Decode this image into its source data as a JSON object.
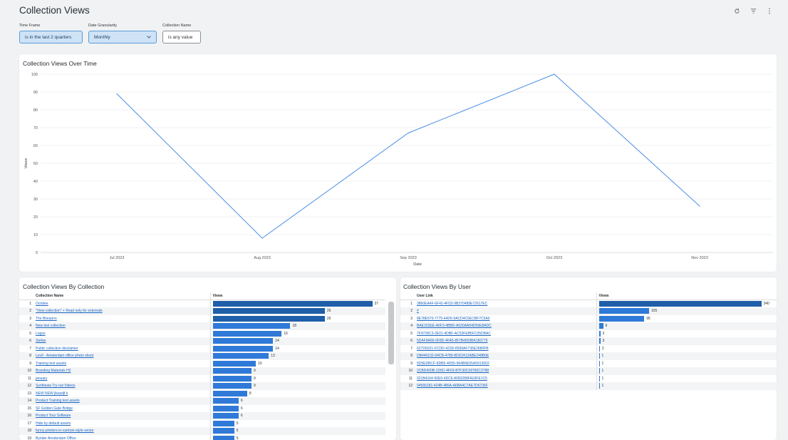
{
  "page": {
    "title": "Collection Views"
  },
  "filters": [
    {
      "label": "Time Frame",
      "value": "is in the last 2 quarters"
    },
    {
      "label": "Date Granularity",
      "value": "Monthly"
    },
    {
      "label": "Collection Name",
      "value": "is any value"
    }
  ],
  "icons": [
    "refresh-icon",
    "filter-icon",
    "more-vert-icon"
  ],
  "colors": {
    "accent": "#4a8fe6",
    "bar_dark": "#1f5ea8",
    "bar_light": "#2f7ad8",
    "link": "#1a66c2"
  },
  "chart_data": {
    "type": "line",
    "title": "Collection Views Over Time",
    "xlabel": "Date",
    "ylabel": "Views",
    "x": [
      "Jul 2023",
      "Aug 2023",
      "Sep 2023",
      "Oct 2023",
      "Nov 2023"
    ],
    "series": [
      {
        "values": [
          89,
          8,
          67,
          100,
          26
        ]
      }
    ],
    "ylim": [
      0,
      100
    ],
    "yticks": [
      0,
      10,
      20,
      30,
      40,
      50,
      60,
      70,
      80,
      90,
      100
    ],
    "grid": true
  },
  "by_collection": {
    "title": "Collection Views By Collection",
    "col_name": "Collection Name",
    "col_views": "Views",
    "max": 37,
    "rows": [
      {
        "n": "1",
        "name": "October",
        "views": 37
      },
      {
        "n": "2",
        "name": "\"View collection\" + Read only for externals",
        "views": 26
      },
      {
        "n": "3",
        "name": "The Bloopers",
        "views": 26
      },
      {
        "n": "4",
        "name": "New test collection",
        "views": 18
      },
      {
        "n": "5",
        "name": "Logos",
        "views": 16
      },
      {
        "n": "6",
        "name": "Stefan",
        "views": 14
      },
      {
        "n": "7",
        "name": "Public collection disclaimer",
        "views": 14
      },
      {
        "n": "8",
        "name": "Lev9 - Amsterdam office photo shoot",
        "views": 13
      },
      {
        "n": "9",
        "name": "Training test assets",
        "views": 10
      },
      {
        "n": "10",
        "name": "Branding Materials H2",
        "views": 9
      },
      {
        "n": "11",
        "name": "january",
        "views": 9
      },
      {
        "n": "12",
        "name": "Synthesia Try-out Videos",
        "views": 9
      },
      {
        "n": "13",
        "name": "NEW NEW jlkasdjf k",
        "views": 8
      },
      {
        "n": "14",
        "name": "Product Training test assets",
        "views": 6
      },
      {
        "n": "15",
        "name": "SF Golden Gate Bridge",
        "views": 6
      },
      {
        "n": "16",
        "name": "Product Tour Software",
        "views": 6
      },
      {
        "n": "17",
        "name": "Hide by default assets",
        "views": 5
      },
      {
        "n": "18",
        "name": "funny-printers-in-cartoon-style-vector",
        "views": 5
      },
      {
        "n": "19",
        "name": "Bynder Amsterdam Office",
        "views": 5
      }
    ]
  },
  "by_user": {
    "title": "Collection Views By User",
    "col_name": "User Link",
    "col_views": "Views",
    "max": 340,
    "rows": [
      {
        "n": "1",
        "name": "3860EA4F-6F42-4FD2-9B370489E72617EC",
        "views": 340
      },
      {
        "n": "2",
        "name": "#",
        "views": 105
      },
      {
        "n": "3",
        "name": "8E78E570-7775-44D6-9ACD4C6ECBF7C5A0",
        "views": 95
      },
      {
        "n": "4",
        "name": "BAE152EE-A6F3-4BBD-A530AA54D56E8ADC",
        "views": 9
      },
      {
        "n": "5",
        "name": "7F9728C3-2E01-4DBF-AC53FEB5FC05DBAC",
        "views": 3
      },
      {
        "n": "6",
        "name": "5DAF9A66-5F8D-4FA5-857B4503BA183775",
        "views": 3
      },
      {
        "n": "7",
        "name": "627D6021-FCDD-423D-8599AF736E2680FB",
        "views": 2
      },
      {
        "n": "8",
        "name": "DB440102-94CB-4789-8DD2412ABE248B0E",
        "views": 1
      },
      {
        "n": "9",
        "name": "5D5EDBCF-8DB5-4D55-964B9E55A5913002",
        "views": 1
      },
      {
        "n": "10",
        "name": "2CBD420B-1D0C-4F63-B7F30C09782C3788",
        "views": 1
      },
      {
        "n": "11",
        "name": "021B4164-50E0-4DC6-8083288FA03FE1C5",
        "views": 1
      },
      {
        "n": "12",
        "name": "04566181-424B-486A-A6BA4C7AE7D6736F",
        "views": 1
      }
    ]
  }
}
